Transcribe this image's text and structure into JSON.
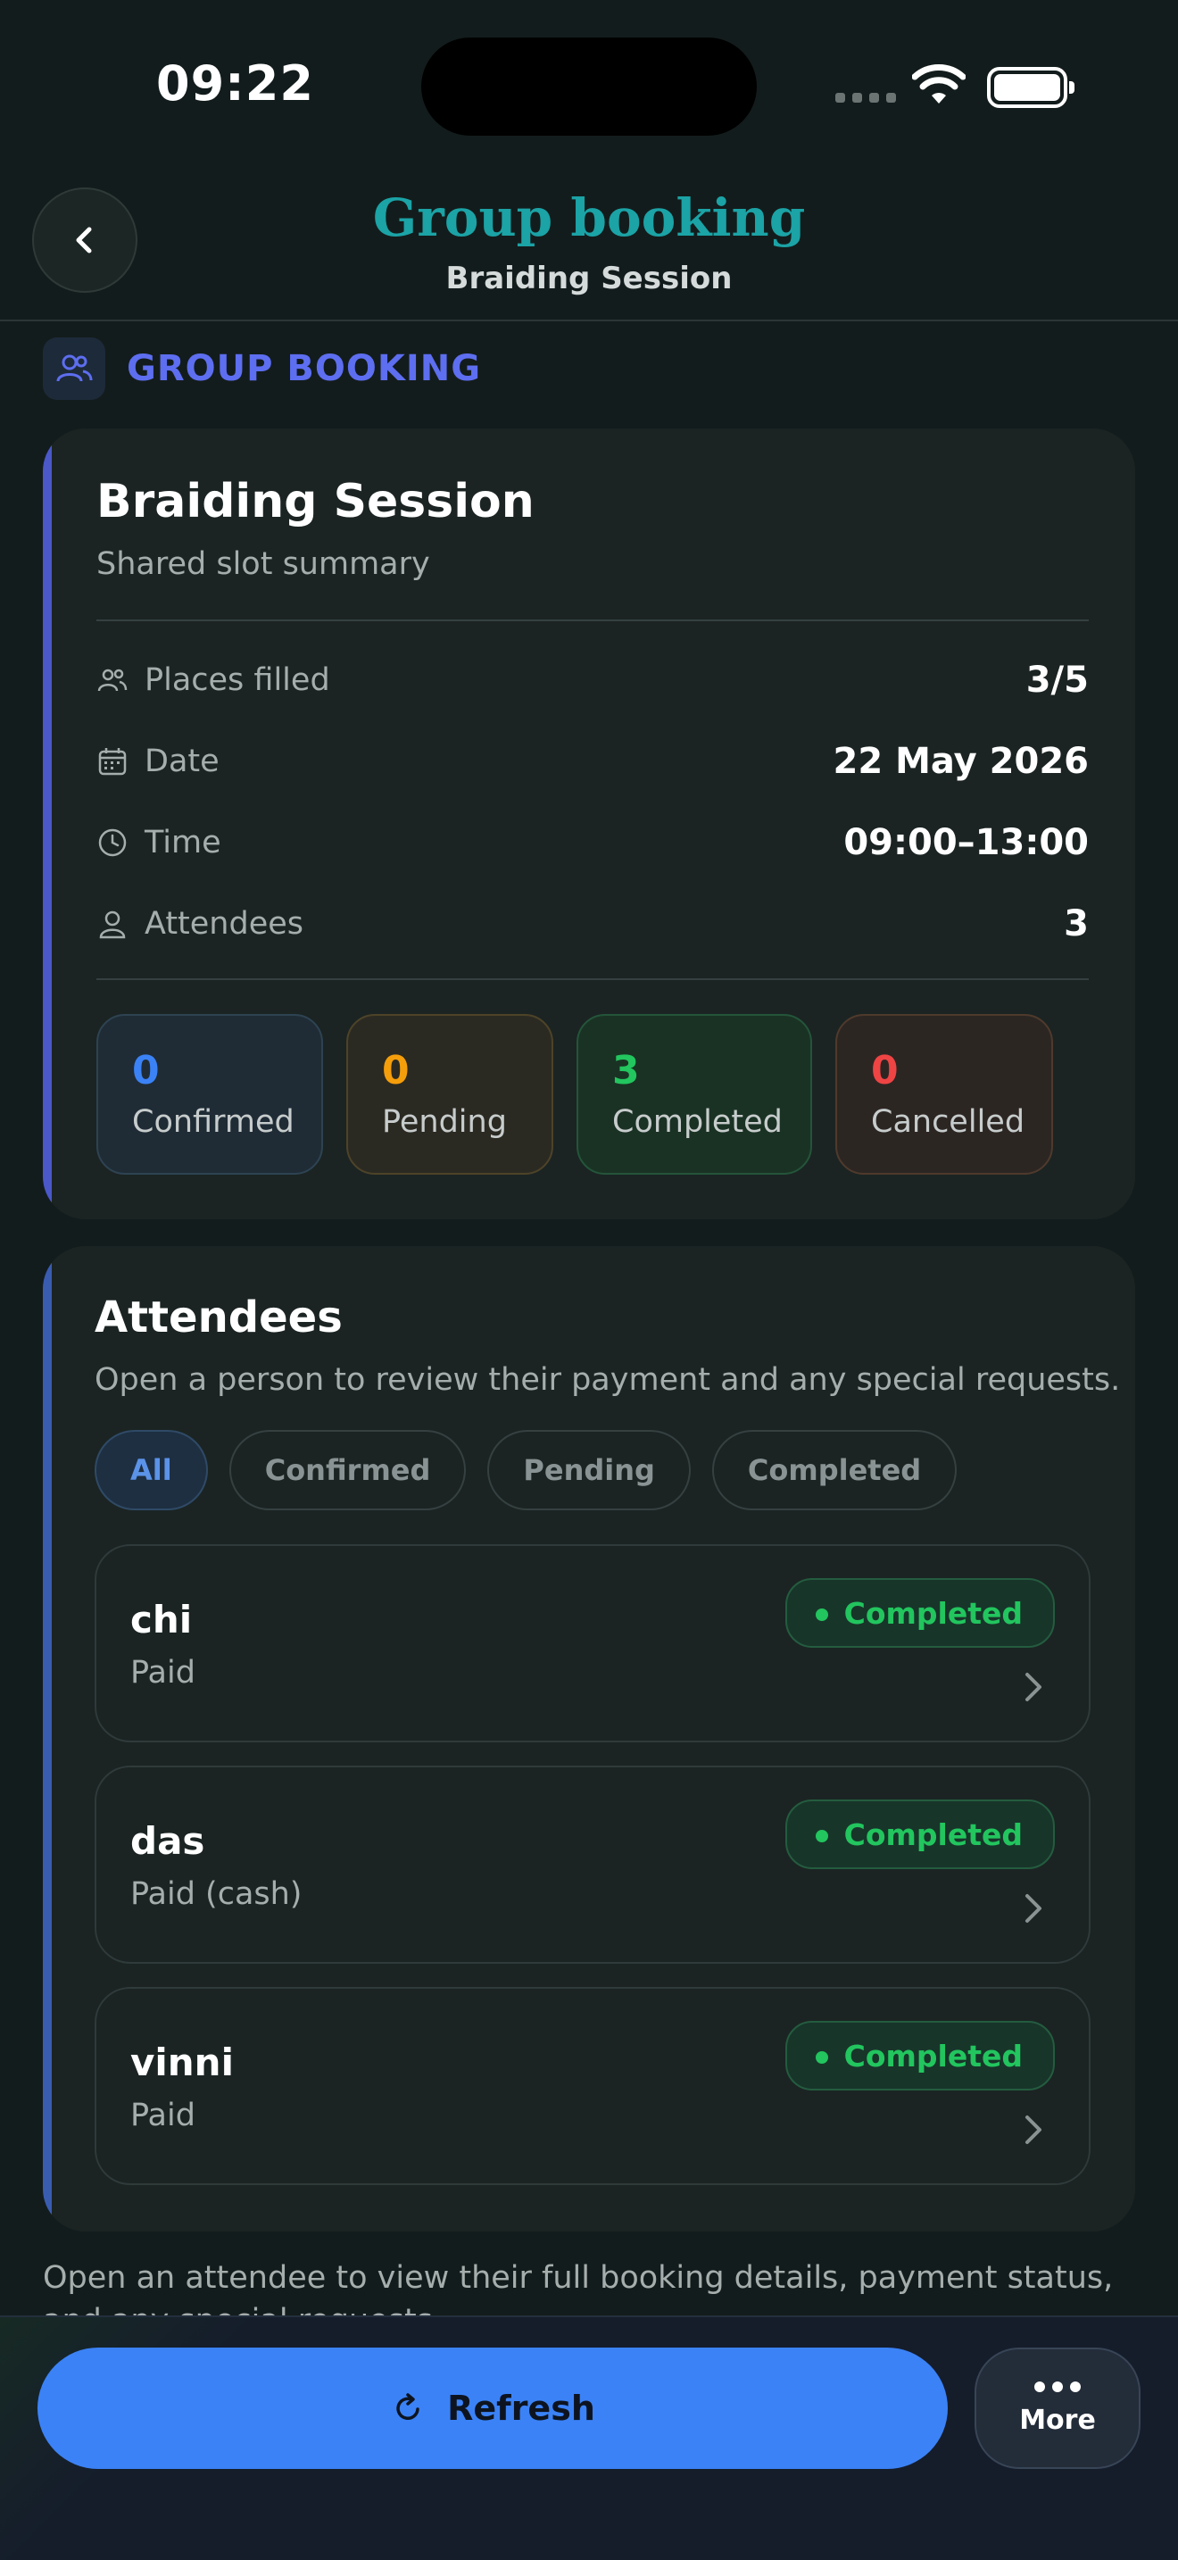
{
  "status_bar": {
    "time": "09:22"
  },
  "header": {
    "title": "Group booking",
    "subtitle": "Braiding Session"
  },
  "section": {
    "label": "GROUP BOOKING"
  },
  "summary": {
    "title": "Braiding Session",
    "subtitle": "Shared slot summary",
    "rows": [
      {
        "icon": "users-icon",
        "label": "Places filled",
        "value": "3/5"
      },
      {
        "icon": "calendar-icon",
        "label": "Date",
        "value": "22 May 2026"
      },
      {
        "icon": "clock-icon",
        "label": "Time",
        "value": "09:00–13:00"
      },
      {
        "icon": "user-icon",
        "label": "Attendees",
        "value": "3"
      }
    ],
    "stats": [
      {
        "value": "0",
        "label": "Confirmed",
        "color": "#3b82f6"
      },
      {
        "value": "0",
        "label": "Pending",
        "color": "#f59e0b"
      },
      {
        "value": "3",
        "label": "Completed",
        "color": "#22c55e"
      },
      {
        "value": "0",
        "label": "Cancelled",
        "color": "#ef4444"
      }
    ]
  },
  "attendees": {
    "title": "Attendees",
    "subtitle": "Open a person to review their payment and any special requests.",
    "filters": [
      "All",
      "Confirmed",
      "Pending",
      "Completed"
    ],
    "active_filter": "All",
    "list": [
      {
        "name": "chi",
        "payment": "Paid",
        "status": "Completed"
      },
      {
        "name": "das",
        "payment": "Paid (cash)",
        "status": "Completed"
      },
      {
        "name": "vinni",
        "payment": "Paid",
        "status": "Completed"
      }
    ]
  },
  "footnote": "Open an attendee to view their full booking details, payment status, and any special requests.",
  "bottom_bar": {
    "refresh_label": "Refresh",
    "more_label": "More"
  },
  "colors": {
    "accent": "#3b82f6",
    "title_teal": "#1ba3a6",
    "section_indigo": "#5d6ef0",
    "success": "#22c55e"
  }
}
